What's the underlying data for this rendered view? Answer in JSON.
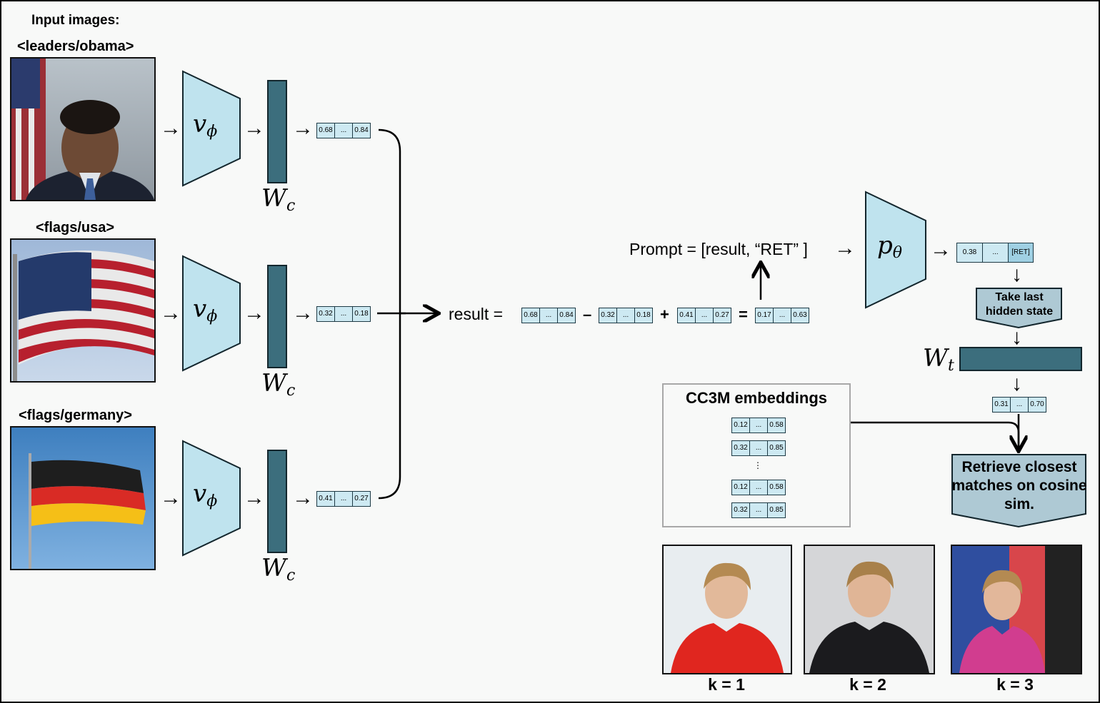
{
  "input_title": "Input images:",
  "images": [
    {
      "label": "<leaders/obama>",
      "vector": [
        "0.68",
        "...",
        "0.84"
      ]
    },
    {
      "label": "<flags/usa>",
      "vector": [
        "0.32",
        "...",
        "0.18"
      ]
    },
    {
      "label": "<flags/germany>",
      "vector": [
        "0.41",
        "...",
        "0.27"
      ]
    }
  ],
  "encoder_symbol": "v",
  "encoder_sub": "ϕ",
  "proj_symbol": "W",
  "proj_sub": "c",
  "result": {
    "label": "result =",
    "terms": [
      [
        "0.68",
        "...",
        "0.84"
      ],
      [
        "0.32",
        "...",
        "0.18"
      ],
      [
        "0.41",
        "...",
        "0.27"
      ]
    ],
    "ops": [
      "–",
      "+",
      "="
    ],
    "output": [
      "0.17",
      "...",
      "0.63"
    ]
  },
  "prompt_text": "Prompt = [result, “RET” ]",
  "llm_symbol": "p",
  "llm_sub": "θ",
  "llm_output": [
    "0.38",
    "...",
    "[RET]"
  ],
  "hidden_state_label": "Take last hidden state",
  "wt_symbol": "W",
  "wt_sub": "t",
  "retrieval_vector": [
    "0.31",
    "...",
    "0.70"
  ],
  "cc3m": {
    "title": "CC3M embeddings",
    "rows": [
      [
        "0.12",
        "...",
        "0.58"
      ],
      [
        "0.32",
        "...",
        "0.85"
      ],
      [
        "0.12",
        "...",
        "0.58"
      ],
      [
        "0.32",
        "...",
        "0.85"
      ]
    ],
    "ellipsis": "⋮"
  },
  "retrieve_label": "Retrieve closest matches on cosine sim.",
  "results": [
    {
      "k": "k = 1"
    },
    {
      "k": "k = 2"
    },
    {
      "k": "k = 3"
    }
  ]
}
